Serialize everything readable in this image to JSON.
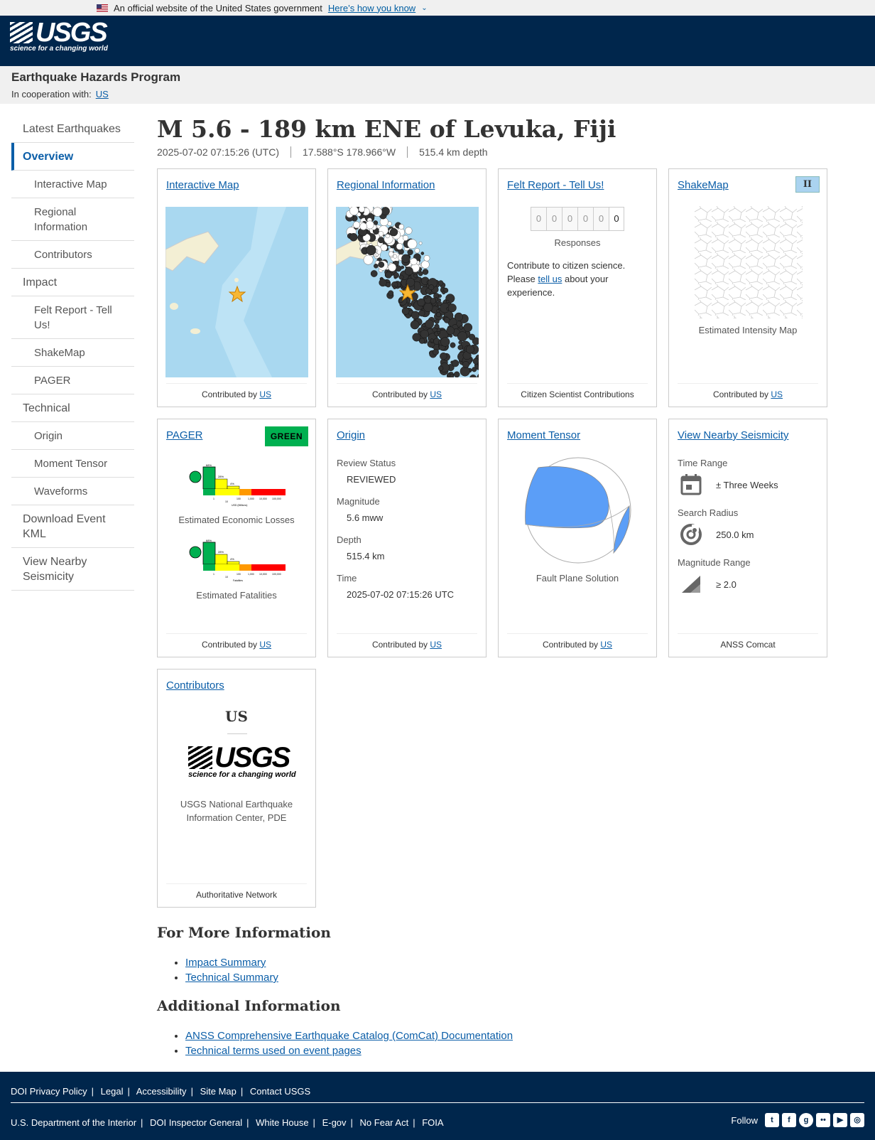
{
  "gov_banner": {
    "text": "An official website of the United States government",
    "link": "Here’s how you know"
  },
  "header": {
    "logo_text": "USGS",
    "tagline": "science for a changing world"
  },
  "subheader": {
    "program": "Earthquake Hazards Program",
    "coop_label": "In cooperation with:",
    "coop_link": "US"
  },
  "sidebar": {
    "items": [
      {
        "label": "Latest Earthquakes"
      },
      {
        "label": "Overview"
      },
      {
        "label": "Interactive Map"
      },
      {
        "label": "Regional Information"
      },
      {
        "label": "Contributors"
      },
      {
        "label": "Impact"
      },
      {
        "label": "Felt Report - Tell Us!"
      },
      {
        "label": "ShakeMap"
      },
      {
        "label": "PAGER"
      },
      {
        "label": "Technical"
      },
      {
        "label": "Origin"
      },
      {
        "label": "Moment Tensor"
      },
      {
        "label": "Waveforms"
      },
      {
        "label": "Download Event KML"
      },
      {
        "label": "View Nearby Seismicity"
      }
    ]
  },
  "event": {
    "title": "M 5.6 - 189 km ENE of Levuka, Fiji",
    "time": "2025-07-02 07:15:26 (UTC)",
    "location": "17.588°S 178.966°W",
    "depth": "515.4 km depth"
  },
  "cards": {
    "interactive_map": {
      "title": "Interactive Map",
      "footer_prefix": "Contributed by",
      "footer_link": "US"
    },
    "regional": {
      "title": "Regional Information",
      "footer_prefix": "Contributed by",
      "footer_link": "US"
    },
    "felt": {
      "title": "Felt Report - Tell Us!",
      "digits": [
        "0",
        "0",
        "0",
        "0",
        "0",
        "0"
      ],
      "responses": "Responses",
      "text1": "Contribute to citizen science. Please",
      "link": "tell us",
      "text2": "about your experience.",
      "footer": "Citizen Scientist Contributions"
    },
    "shakemap": {
      "title": "ShakeMap",
      "badge": "II",
      "caption": "Estimated Intensity Map",
      "footer_prefix": "Contributed by",
      "footer_link": "US"
    },
    "pager": {
      "title": "PAGER",
      "badge": "GREEN",
      "econ": "Estimated Economic Losses",
      "fatal": "Estimated Fatalities",
      "footer_prefix": "Contributed by",
      "footer_link": "US",
      "hist_pct": [
        "68%",
        "28%",
        "4%"
      ],
      "econ_axis": "USD (Millions)",
      "fatal_axis": "Fatalities",
      "ticks": [
        "1",
        "10",
        "100",
        "1,000",
        "10,000",
        "100,000"
      ]
    },
    "origin": {
      "title": "Origin",
      "review_label": "Review Status",
      "review": "REVIEWED",
      "mag_label": "Magnitude",
      "mag": "5.6 mww",
      "depth_label": "Depth",
      "depth": "515.4 km",
      "time_label": "Time",
      "time": "2025-07-02 07:15:26 UTC",
      "footer_prefix": "Contributed by",
      "footer_link": "US"
    },
    "moment": {
      "title": "Moment Tensor",
      "caption": "Fault Plane Solution",
      "footer_prefix": "Contributed by",
      "footer_link": "US"
    },
    "nearby": {
      "title": "View Nearby Seismicity",
      "range_label": "Time Range",
      "range": "± Three Weeks",
      "radius_label": "Search Radius",
      "radius": "250.0 km",
      "mag_label": "Magnitude Range",
      "mag": "≥ 2.0",
      "footer": "ANSS Comcat"
    },
    "contributors": {
      "title": "Contributors",
      "code": "US",
      "logo_text": "USGS",
      "tagline": "science for a changing world",
      "name": "USGS National Earthquake Information Center, PDE",
      "footer": "Authoritative Network"
    }
  },
  "more_info": {
    "title": "For More Information",
    "links": [
      "Impact Summary",
      "Technical Summary"
    ]
  },
  "additional": {
    "title": "Additional Information",
    "links": [
      "ANSS Comprehensive Earthquake Catalog (ComCat) Documentation",
      "Technical terms used on event pages"
    ]
  },
  "footer": {
    "row1": [
      "DOI Privacy Policy",
      "Legal",
      "Accessibility",
      "Site Map",
      "Contact USGS"
    ],
    "row2": [
      "U.S. Department of the Interior",
      "DOI Inspector General",
      "White House",
      "E-gov",
      "No Fear Act",
      "FOIA"
    ],
    "follow": "Follow",
    "social": [
      "twitter-icon",
      "facebook-icon",
      "github-icon",
      "flickr-icon",
      "youtube-icon",
      "instagram-icon"
    ]
  }
}
